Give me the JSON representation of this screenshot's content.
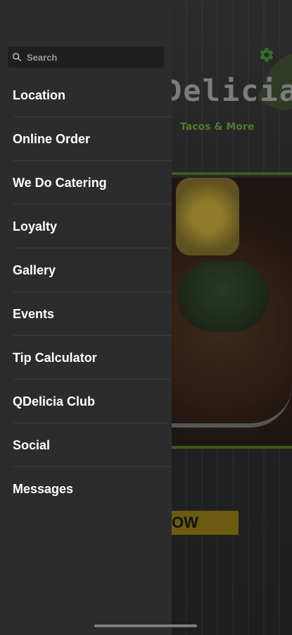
{
  "drawer": {
    "search_placeholder": "Search",
    "items": [
      {
        "label": "Location"
      },
      {
        "label": "Online Order"
      },
      {
        "label": "We Do Catering"
      },
      {
        "label": "Loyalty"
      },
      {
        "label": "Gallery"
      },
      {
        "label": "Events"
      },
      {
        "label": "Tip Calculator"
      },
      {
        "label": "QDelicia Club"
      },
      {
        "label": "Social"
      },
      {
        "label": "Messages"
      }
    ]
  },
  "background": {
    "logo_text": "Delicia",
    "logo_subtitle": "Tacos & More",
    "cta_text": "OW",
    "icons": [
      "gear-icon"
    ]
  },
  "colors": {
    "drawer_bg": "#2c2c2c",
    "text": "#ffffff",
    "accent_green": "#2f6f2a"
  }
}
